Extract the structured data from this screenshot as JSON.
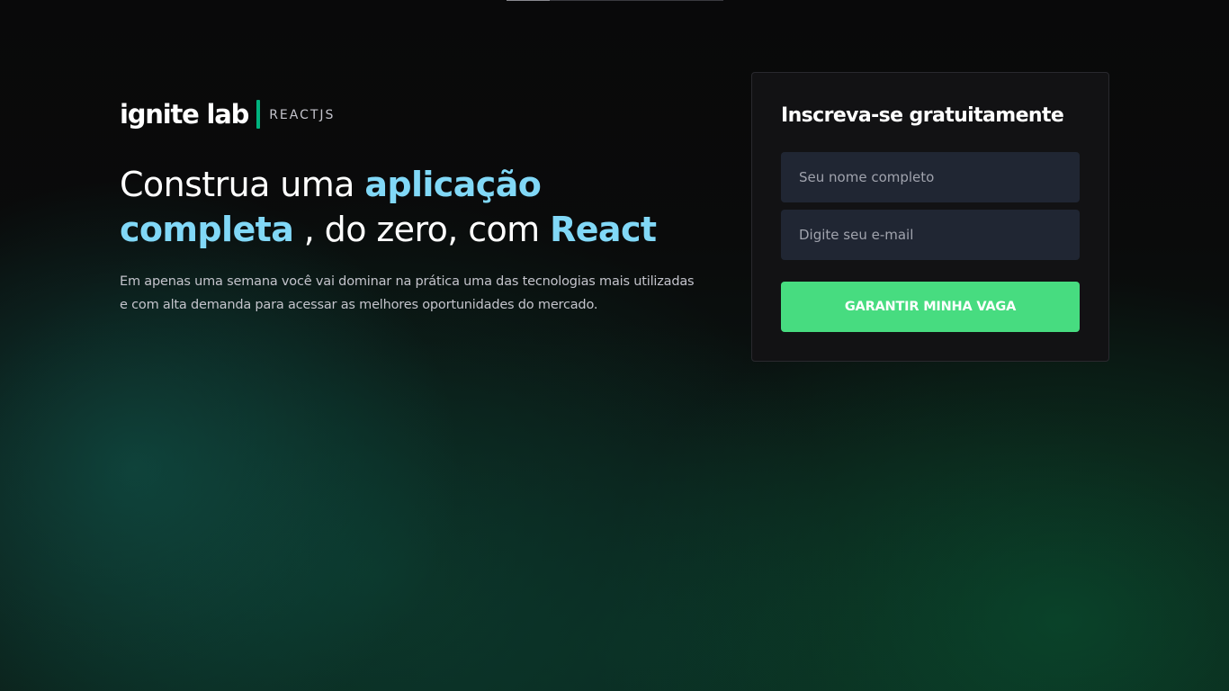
{
  "logo": {
    "brand": "ignite lab",
    "track": "REACTJS"
  },
  "hero": {
    "headline": {
      "part1": "Construa uma ",
      "highlight1": "aplicação completa",
      "part2": " , do zero, com ",
      "highlight2": "React"
    },
    "description": "Em apenas uma semana você vai dominar na prática uma das tecnologias mais utilizadas e com alta demanda para acessar as melhores oportunidades do mercado."
  },
  "signup": {
    "title": "Inscreva-se gratuitamente",
    "name_placeholder": "Seu nome completo",
    "email_placeholder": "Digite seu e-mail",
    "submit_label": "GARANTIR MINHA VAGA"
  },
  "colors": {
    "accent_blue": "#81d8f7",
    "accent_green": "#00b37e",
    "button_green": "#47dc80",
    "card_bg": "#121214",
    "input_bg": "#202633"
  }
}
